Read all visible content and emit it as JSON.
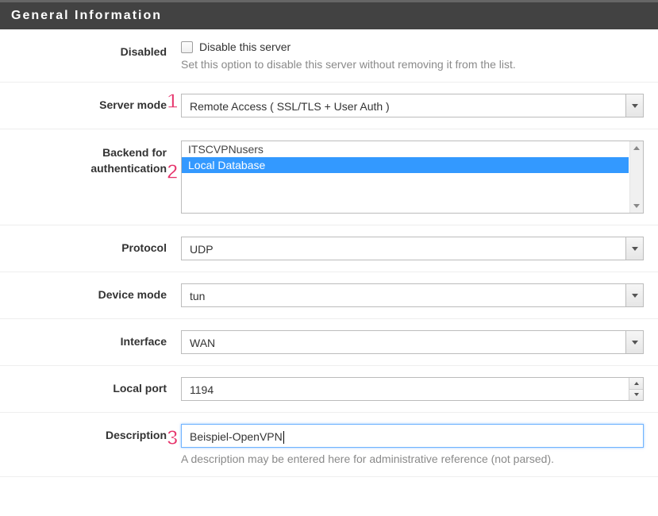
{
  "section_title": "General Information",
  "annotations": {
    "a1": "1",
    "a2": "2",
    "a3": "3"
  },
  "fields": {
    "disabled_label": "Disabled",
    "disabled_checkbox_text": "Disable this server",
    "disabled_help": "Set this option to disable this server without removing it from the list.",
    "server_mode_label": "Server mode",
    "server_mode_value": "Remote Access ( SSL/TLS + User Auth )",
    "backend_auth_label_l1": "Backend for",
    "backend_auth_label_l2": "authentication",
    "backend_auth_options": [
      {
        "label": "ITSCVPNusers",
        "selected": false
      },
      {
        "label": "Local Database",
        "selected": true
      }
    ],
    "protocol_label": "Protocol",
    "protocol_value": "UDP",
    "device_mode_label": "Device mode",
    "device_mode_value": "tun",
    "interface_label": "Interface",
    "interface_value": "WAN",
    "local_port_label": "Local port",
    "local_port_value": "1194",
    "description_label": "Description",
    "description_value": "Beispiel-OpenVPN",
    "description_help": "A description may be entered here for administrative reference (not parsed)."
  }
}
